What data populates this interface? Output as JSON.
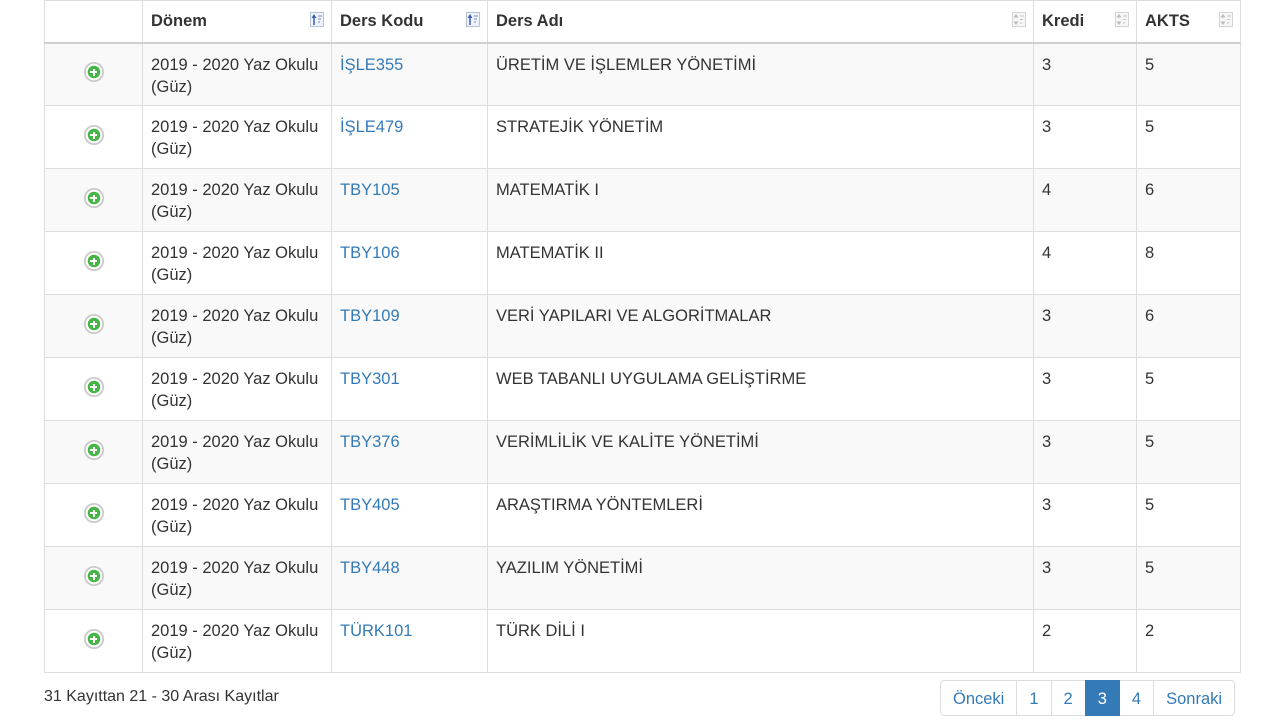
{
  "table": {
    "headers": [
      "",
      "Dönem",
      "Ders Kodu",
      "Ders Adı",
      "Kredi",
      "AKTS"
    ],
    "rows": [
      {
        "donem_1": "2019 - 2020 Yaz Okulu",
        "donem_2": "(Güz)",
        "code": "İŞLE355",
        "name": "ÜRETİM VE İŞLEMLER YÖNETİMİ",
        "kredi": "3",
        "akts": "5"
      },
      {
        "donem_1": "2019 - 2020 Yaz Okulu",
        "donem_2": "(Güz)",
        "code": "İŞLE479",
        "name": "STRATEJİK YÖNETİM",
        "kredi": "3",
        "akts": "5"
      },
      {
        "donem_1": "2019 - 2020 Yaz Okulu",
        "donem_2": "(Güz)",
        "code": "TBY105",
        "name": "MATEMATİK I",
        "kredi": "4",
        "akts": "6"
      },
      {
        "donem_1": "2019 - 2020 Yaz Okulu",
        "donem_2": "(Güz)",
        "code": "TBY106",
        "name": "MATEMATİK II",
        "kredi": "4",
        "akts": "8"
      },
      {
        "donem_1": "2019 - 2020 Yaz Okulu",
        "donem_2": "(Güz)",
        "code": "TBY109",
        "name": "VERİ YAPILARI VE ALGORİTMALAR",
        "kredi": "3",
        "akts": "6"
      },
      {
        "donem_1": "2019 - 2020 Yaz Okulu",
        "donem_2": "(Güz)",
        "code": "TBY301",
        "name": "WEB TABANLI UYGULAMA GELİŞTİRME",
        "kredi": "3",
        "akts": "5"
      },
      {
        "donem_1": "2019 - 2020 Yaz Okulu",
        "donem_2": "(Güz)",
        "code": "TBY376",
        "name": "VERİMLİLİK VE KALİTE YÖNETİMİ",
        "kredi": "3",
        "akts": "5"
      },
      {
        "donem_1": "2019 - 2020 Yaz Okulu",
        "donem_2": "(Güz)",
        "code": "TBY405",
        "name": "ARAŞTIRMA YÖNTEMLERİ",
        "kredi": "3",
        "akts": "5"
      },
      {
        "donem_1": "2019 - 2020 Yaz Okulu",
        "donem_2": "(Güz)",
        "code": "TBY448",
        "name": "YAZILIM YÖNETİMİ",
        "kredi": "3",
        "akts": "5"
      },
      {
        "donem_1": "2019 - 2020 Yaz Okulu",
        "donem_2": "(Güz)",
        "code": "TÜRK101",
        "name": "TÜRK DİLİ I",
        "kredi": "2",
        "akts": "2"
      }
    ]
  },
  "footer": {
    "info_text": "31 Kayıttan 21 - 30 Arası Kayıtlar"
  },
  "pagination": {
    "prev_label": "Önceki",
    "pages": [
      "1",
      "2",
      "3",
      "4"
    ],
    "active_page": "3",
    "next_label": "Sonraki"
  },
  "icons": {
    "row_action": "plus-circle-icon",
    "sort_active": "sort-asc-icon",
    "sort_inactive": "sort-both-icon"
  },
  "colors": {
    "link": "#337ab7",
    "active_page_bg": "#337ab7",
    "plus_icon": "#45b545",
    "striped_row": "#f9f9f9",
    "border": "#dddddd"
  }
}
